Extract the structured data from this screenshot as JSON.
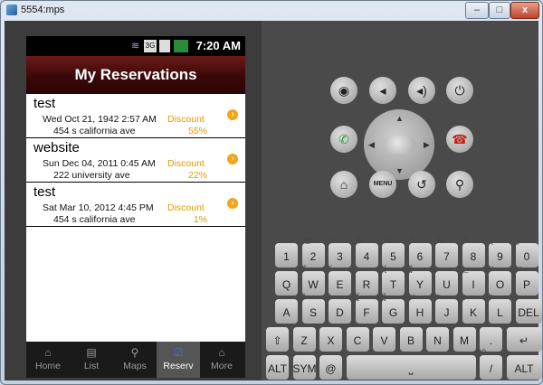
{
  "window": {
    "title": "5554:mps",
    "min": "–",
    "max": "□",
    "close": "x"
  },
  "phone": {
    "status": {
      "time": "7:20 AM",
      "net": "3G"
    },
    "header": {
      "title": "My Reservations"
    },
    "reservations": [
      {
        "name": "test",
        "date": "Wed Oct 21, 1942 2:57 AM",
        "address": "454 s california ave",
        "discount_label": "Discount",
        "discount": "55%"
      },
      {
        "name": "website",
        "date": "Sun Dec 04, 2011 0:45 AM",
        "address": "222 university ave",
        "discount_label": "Discount",
        "discount": "22%"
      },
      {
        "name": "test",
        "date": "Sat Mar 10, 2012 4:45 PM",
        "address": "454 s california ave",
        "discount_label": "Discount",
        "discount": "1%"
      }
    ],
    "tabs": [
      {
        "label": "Home",
        "icon": "home-icon"
      },
      {
        "label": "List",
        "icon": "list-icon"
      },
      {
        "label": "Maps",
        "icon": "map-pin-icon"
      },
      {
        "label": "Reserv",
        "icon": "checkbox-icon"
      },
      {
        "label": "More",
        "icon": "more-icon"
      }
    ]
  },
  "controls": {
    "menu": "MENU"
  },
  "keyboard": {
    "row1": [
      {
        "k": "1",
        "a": "!"
      },
      {
        "k": "2",
        "a": "@"
      },
      {
        "k": "3",
        "a": "#"
      },
      {
        "k": "4",
        "a": "$"
      },
      {
        "k": "5",
        "a": "%"
      },
      {
        "k": "6",
        "a": "^"
      },
      {
        "k": "7",
        "a": "&"
      },
      {
        "k": "8",
        "a": "*"
      },
      {
        "k": "9",
        "a": "("
      },
      {
        "k": "0",
        "a": ")"
      }
    ],
    "row2": [
      {
        "k": "Q",
        "a": "~"
      },
      {
        "k": "W",
        "a": "\""
      },
      {
        "k": "E",
        "a": "´"
      },
      {
        "k": "R",
        "a": ""
      },
      {
        "k": "T",
        "a": "{"
      },
      {
        "k": "Y",
        "a": "}"
      },
      {
        "k": "U",
        "a": "-"
      },
      {
        "k": "I",
        "a": "_"
      },
      {
        "k": "O",
        "a": "+"
      },
      {
        "k": "P",
        "a": "="
      }
    ],
    "row3": [
      {
        "k": "A",
        "a": ""
      },
      {
        "k": "S",
        "a": "\\"
      },
      {
        "k": "D",
        "a": ""
      },
      {
        "k": "F",
        "a": "["
      },
      {
        "k": "G",
        "a": "]"
      },
      {
        "k": "H",
        "a": "<"
      },
      {
        "k": "J",
        "a": ">"
      },
      {
        "k": "K",
        "a": ";"
      },
      {
        "k": "L",
        "a": ":"
      }
    ],
    "row4": [
      {
        "k": "Z",
        "a": ""
      },
      {
        "k": "X",
        "a": ""
      },
      {
        "k": "C",
        "a": ""
      },
      {
        "k": "V",
        "a": ""
      },
      {
        "k": "B",
        "a": ""
      },
      {
        "k": "N",
        "a": ""
      },
      {
        "k": "M",
        "a": ""
      },
      {
        "k": ".",
        "a": ""
      }
    ],
    "del": "DEL",
    "alt": "ALT",
    "sym": "SYM",
    "at": "@",
    "slash": "/",
    "comma": ",",
    "question": "?"
  }
}
